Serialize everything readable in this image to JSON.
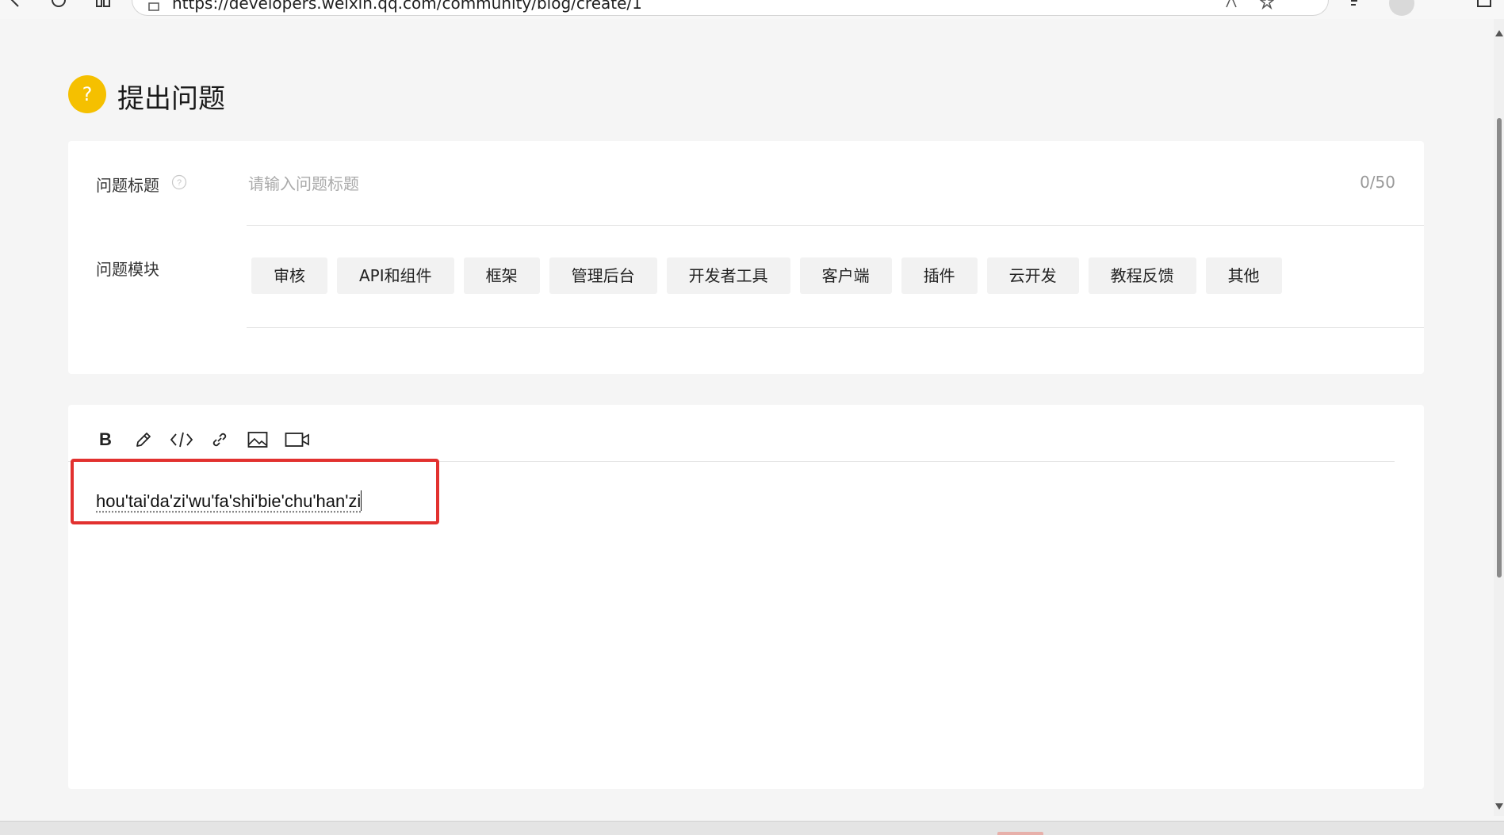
{
  "browser": {
    "url": "https://developers.weixin.qq.com/community/blog/create/1"
  },
  "page": {
    "title": "提出问题",
    "title_icon": "?"
  },
  "form": {
    "title_label": "问题标题",
    "title_placeholder": "请输入问题标题",
    "title_value": "",
    "title_counter": "0/50",
    "module_label": "问题模块",
    "modules": [
      "审核",
      "API和组件",
      "框架",
      "管理后台",
      "开发者工具",
      "客户端",
      "插件",
      "云开发",
      "教程反馈",
      "其他"
    ]
  },
  "editor": {
    "toolbar": {
      "bold_label": "B",
      "tools": [
        "bold-icon",
        "pencil-icon",
        "code-icon",
        "link-icon",
        "image-icon",
        "video-icon"
      ]
    },
    "content": "hou'tai'da'zi'wu'fa'shi'bie'chu'han'zi"
  },
  "colors": {
    "accent_yellow": "#f5c000",
    "highlight_red": "#e2312f",
    "chip_bg": "#f2f2f2"
  }
}
